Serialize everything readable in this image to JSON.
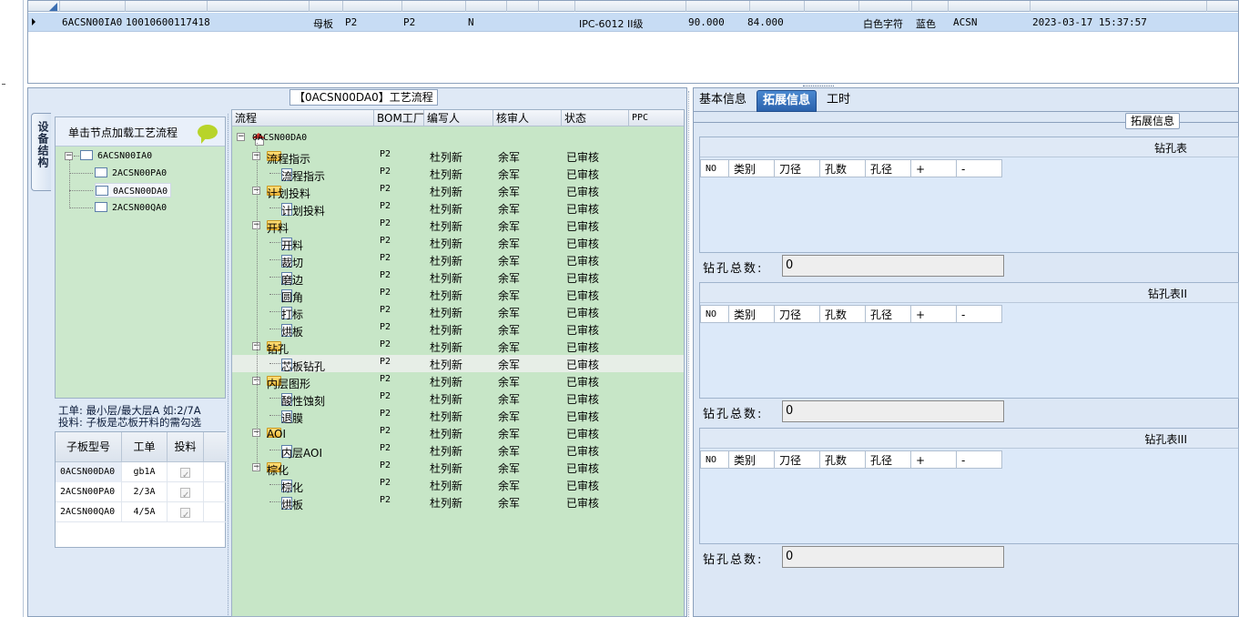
{
  "top_grid": {
    "row": {
      "c1": "6ACSN00IA0",
      "c2": "10010600117418",
      "c3": "母板",
      "c4": "P2",
      "c5": "P2",
      "c6": "N",
      "c7": "IPC-6012 II级",
      "c8": "90.000",
      "c9": "84.000",
      "c10": "白色字符",
      "c11": "蓝色",
      "c12": "ACSN",
      "c13": "2023-03-17 15:37:57"
    }
  },
  "left": {
    "side_tab": "设备结构",
    "struct_header": "单击节点加载工艺流程",
    "tree": {
      "root": "6ACSN00IA0",
      "children": [
        "2ACSN00PA0",
        "0ACSN00DA0",
        "2ACSN00QA0"
      ]
    },
    "note": {
      "line1": "工单: 最小层/最大层A 如:2/7A",
      "line2": "投料: 子板是芯板开料的需勾选"
    },
    "sub_grid": {
      "headers": [
        "子板型号",
        "工单",
        "投料"
      ],
      "rows": [
        {
          "model": "0ACSN00DA0",
          "order": "gb1A"
        },
        {
          "model": "2ACSN00PA0",
          "order": "2/3A"
        },
        {
          "model": "2ACSN00QA0",
          "order": "4/5A"
        }
      ]
    }
  },
  "process": {
    "title": "【0ACSN00DA0】工艺流程",
    "headers": [
      "流程",
      "BOM工厂",
      "编写人",
      "核审人",
      "状态",
      "PPC"
    ],
    "root": "0ACSN00DA0",
    "rows": [
      {
        "name": "流程指示",
        "bom": "P2",
        "writer": "杜列新",
        "reviewer": "余军",
        "status": "已审核"
      },
      {
        "name": "流程指示",
        "bom": "P2",
        "writer": "杜列新",
        "reviewer": "余军",
        "status": "已审核"
      },
      {
        "name": "计划投料",
        "bom": "P2",
        "writer": "杜列新",
        "reviewer": "余军",
        "status": "已审核"
      },
      {
        "name": "计划投料",
        "bom": "P2",
        "writer": "杜列新",
        "reviewer": "余军",
        "status": "已审核"
      },
      {
        "name": "开料",
        "bom": "P2",
        "writer": "杜列新",
        "reviewer": "余军",
        "status": "已审核"
      },
      {
        "name": "开料",
        "bom": "P2",
        "writer": "杜列新",
        "reviewer": "余军",
        "status": "已审核"
      },
      {
        "name": "裁切",
        "bom": "P2",
        "writer": "杜列新",
        "reviewer": "余军",
        "status": "已审核"
      },
      {
        "name": "磨边",
        "bom": "P2",
        "writer": "杜列新",
        "reviewer": "余军",
        "status": "已审核"
      },
      {
        "name": "圆角",
        "bom": "P2",
        "writer": "杜列新",
        "reviewer": "余军",
        "status": "已审核"
      },
      {
        "name": "打标",
        "bom": "P2",
        "writer": "杜列新",
        "reviewer": "余军",
        "status": "已审核"
      },
      {
        "name": "烘板",
        "bom": "P2",
        "writer": "杜列新",
        "reviewer": "余军",
        "status": "已审核"
      },
      {
        "name": "钻孔",
        "bom": "P2",
        "writer": "杜列新",
        "reviewer": "余军",
        "status": "已审核"
      },
      {
        "name": "芯板钻孔",
        "bom": "P2",
        "writer": "杜列新",
        "reviewer": "余军",
        "status": "已审核"
      },
      {
        "name": "内层图形",
        "bom": "P2",
        "writer": "杜列新",
        "reviewer": "余军",
        "status": "已审核"
      },
      {
        "name": "酸性蚀刻",
        "bom": "P2",
        "writer": "杜列新",
        "reviewer": "余军",
        "status": "已审核"
      },
      {
        "name": "退膜",
        "bom": "P2",
        "writer": "杜列新",
        "reviewer": "余军",
        "status": "已审核"
      },
      {
        "name": "AOI",
        "bom": "P2",
        "writer": "杜列新",
        "reviewer": "余军",
        "status": "已审核"
      },
      {
        "name": "内层AOI",
        "bom": "P2",
        "writer": "杜列新",
        "reviewer": "余军",
        "status": "已审核"
      },
      {
        "name": "棕化",
        "bom": "P2",
        "writer": "杜列新",
        "reviewer": "余军",
        "status": "已审核"
      },
      {
        "name": "棕化",
        "bom": "P2",
        "writer": "杜列新",
        "reviewer": "余军",
        "status": "已审核"
      },
      {
        "name": "烘板",
        "bom": "P2",
        "writer": "杜列新",
        "reviewer": "余军",
        "status": "已审核"
      }
    ]
  },
  "right": {
    "tabs": [
      "基本信息",
      "拓展信息",
      "工时"
    ],
    "group_label": "拓展信息",
    "columns": [
      "NO",
      "类别",
      "刀径",
      "孔数",
      "孔径",
      "+",
      "-"
    ],
    "tables": [
      {
        "title": "钻孔表",
        "total_label": "钻孔总数:",
        "total_value": "0"
      },
      {
        "title": "钻孔表II",
        "total_label": "钻孔总数:",
        "total_value": "0"
      },
      {
        "title": "钻孔表III",
        "total_label": "钻孔总数:",
        "total_value": "0"
      }
    ]
  }
}
